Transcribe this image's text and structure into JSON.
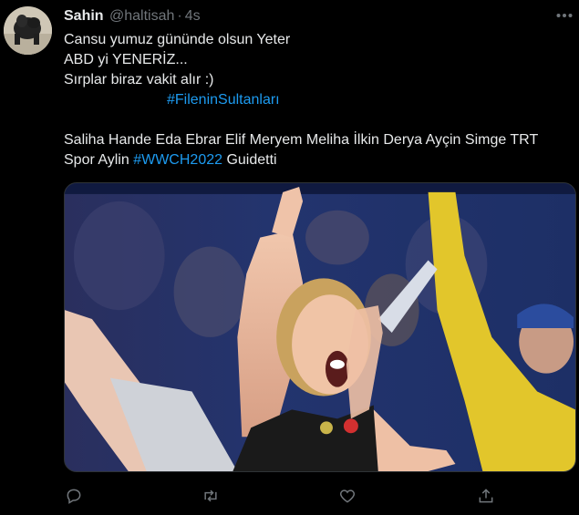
{
  "tweet": {
    "author_name": "Sahin",
    "author_handle": "@haltisah",
    "separator": "·",
    "time_ago": "4s",
    "lines": [
      "Cansu yumuz gününde olsun Yeter",
      "ABD yi YENERİZ...",
      "Sırplar biraz vakit alır :)"
    ],
    "hashtag_line": "#FileninSultanları",
    "names_line_1": "Saliha Hande Eda Ebrar Elif Meryem Meliha İlkin Derya Ayçin Simge TRT",
    "names_line_2_prefix": "Spor Aylin ",
    "names_line_2_hashtag": "#WWCH2022",
    "names_line_2_suffix": " Guidetti"
  },
  "icons": {
    "more": "more-horizontal-icon",
    "reply": "reply-icon",
    "retweet": "retweet-icon",
    "like": "heart-icon",
    "share": "share-icon"
  },
  "colors": {
    "background": "#000000",
    "text": "#e7e9ea",
    "muted": "#71767b",
    "link": "#1d9bf0"
  }
}
